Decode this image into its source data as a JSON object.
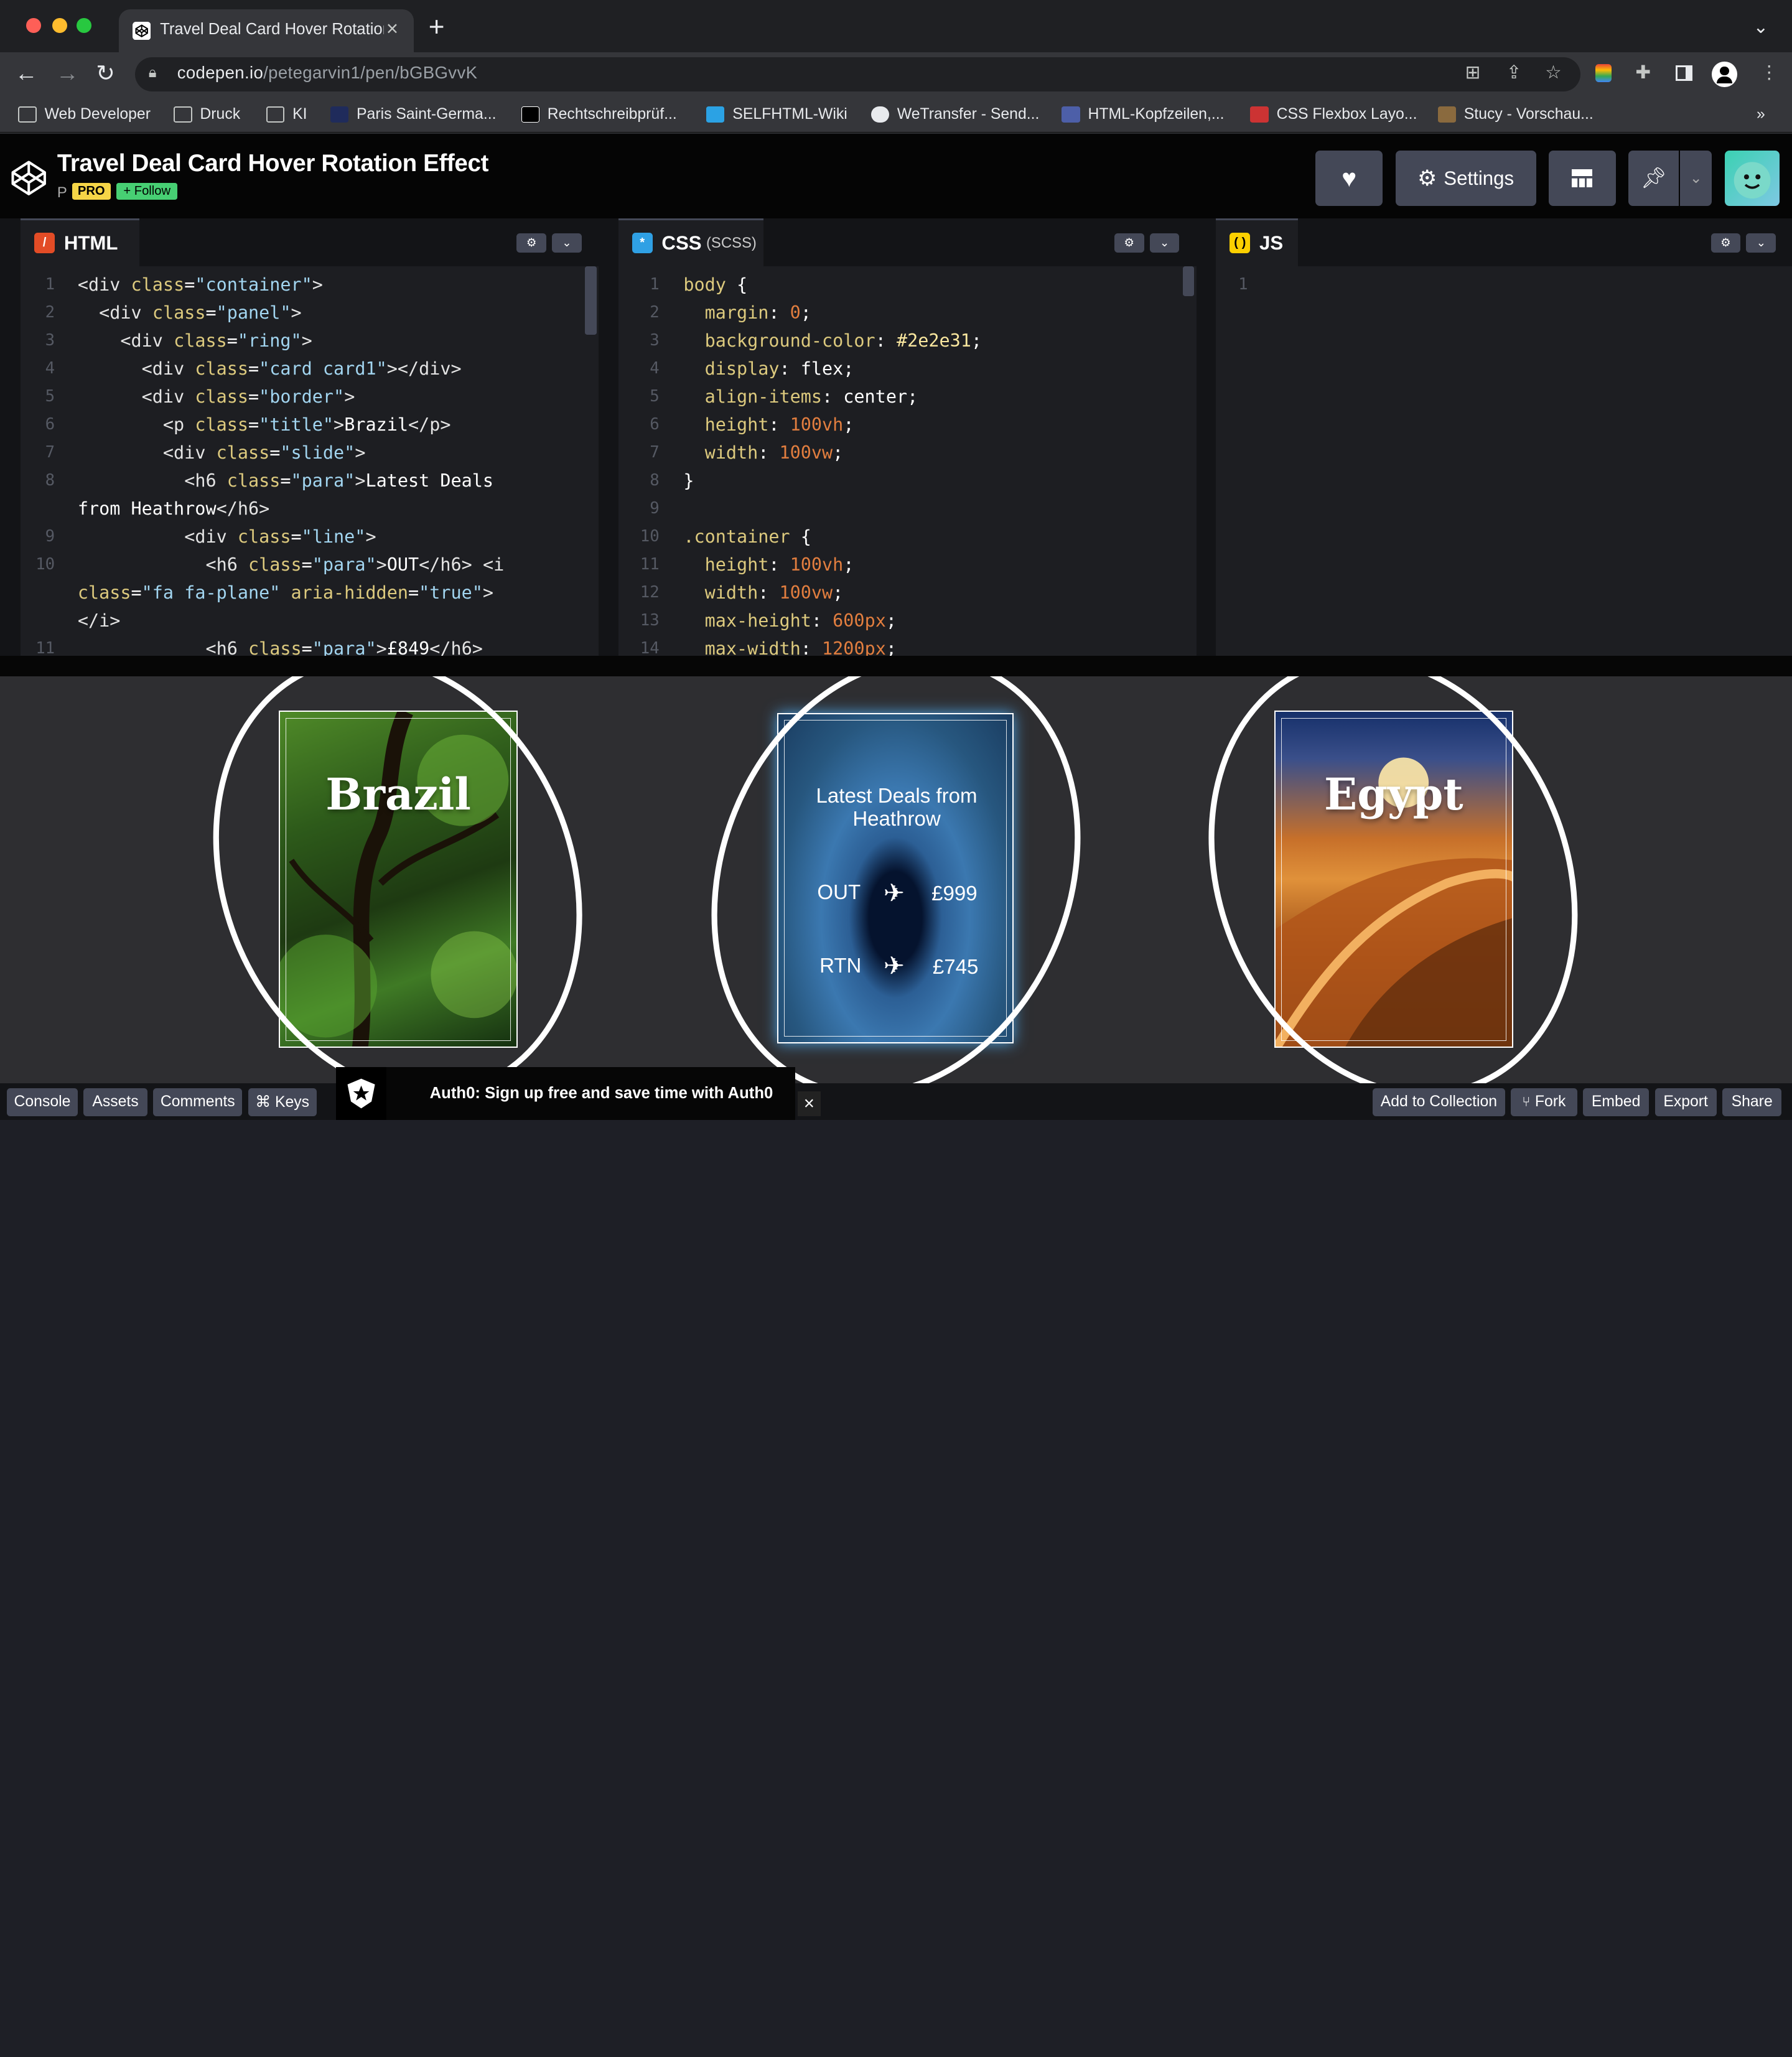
{
  "browser": {
    "tab_title": "Travel Deal Card Hover Rotation Effect",
    "url_host": "codepen.io",
    "url_path": "/petegarvin1/pen/bGBGvvK",
    "bookmarks": [
      "Web Developer",
      "Druck",
      "KI",
      "Paris Saint-Germa...",
      "Rechtschreibprüf...",
      "SELFHTML-Wiki",
      "WeTransfer - Send...",
      "HTML-Kopfzeilen,...",
      "CSS Flexbox Layo...",
      "Stucy - Vorschau..."
    ],
    "bookmarks_more": "»"
  },
  "pen": {
    "title": "Travel Deal Card Hover Rotation Effect",
    "author_initial": "P",
    "badge": "PRO",
    "follow_label": "+ Follow",
    "settings_label": "Settings"
  },
  "editors": {
    "html": {
      "label": "HTML",
      "line_numbers": [
        "1",
        "2",
        "3",
        "4",
        "5",
        "6",
        "7",
        "8",
        "",
        "9",
        "10",
        "",
        "",
        "11"
      ]
    },
    "css": {
      "label": "CSS",
      "sub": "(SCSS)",
      "line_numbers": [
        "1",
        "2",
        "3",
        "4",
        "5",
        "6",
        "7",
        "8",
        "9",
        "10",
        "11",
        "12",
        "13",
        "14"
      ]
    },
    "js": {
      "label": "JS",
      "line_numbers": [
        "1"
      ]
    }
  },
  "result": {
    "card1_title": "Brazil",
    "card2_heading": "Latest Deals from Heathrow",
    "card2_out_label": "OUT",
    "card2_out_price": "£999",
    "card2_rtn_label": "RTN",
    "card2_rtn_price": "£745",
    "card3_title": "Egypt"
  },
  "footer": {
    "console": "Console",
    "assets": "Assets",
    "comments": "Comments",
    "keys": "⌘ Keys",
    "ad_text": "Auth0: Sign up free and save time with Auth0",
    "add_collection": "Add to Collection",
    "fork": "Fork",
    "embed": "Embed",
    "export": "Export",
    "share": "Share"
  },
  "colors": {
    "codepen_bg": "#131417",
    "editor_bg": "#1d1e22",
    "button_bg": "#444857",
    "pro_badge": "#f5d547",
    "follow_badge": "#47cf73",
    "result_bg": "#2e2e31"
  }
}
